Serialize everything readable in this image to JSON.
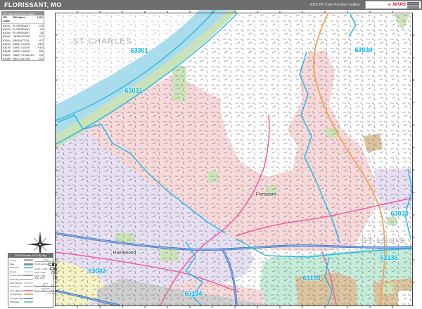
{
  "title_bar": {
    "title": "FLORISSANT, MO",
    "edition": "2020 ZIP Code Premium Edition",
    "logo_text": "MAPS"
  },
  "zip_index": {
    "header": "ZIP Code Index/Grid Locator",
    "columns": [
      "ZIP Code",
      "ZIP Name",
      "LOC"
    ],
    "rows": [
      {
        "code": "63031",
        "name": "FLORISSANT",
        "loc": "E5"
      },
      {
        "code": "63033",
        "name": "FLORISSANT",
        "loc": "L8"
      },
      {
        "code": "63034",
        "name": "FLORISSANT",
        "loc": "J3"
      },
      {
        "code": "63042",
        "name": "HAZELWOOD",
        "loc": "D7"
      },
      {
        "code": "63044",
        "name": "BRIDGETON",
        "loc": "B7"
      },
      {
        "code": "63134",
        "name": "SAINT LOUIS",
        "loc": "G10"
      },
      {
        "code": "63135",
        "name": "SAINT LOUIS",
        "loc": "K10"
      },
      {
        "code": "63136",
        "name": "SAINT LOUIS",
        "loc": "M9"
      },
      {
        "code": "63301",
        "name": "SAINT CHARLES",
        "loc": "D6"
      },
      {
        "code": "63386",
        "name": "WEST ALTON",
        "loc": "G1"
      }
    ]
  },
  "legend": {
    "header": "2020 Florissant, MO City Map",
    "items": [
      {
        "label": "County",
        "color": "#b3b3b3"
      },
      {
        "label": "State",
        "color": "#8c8c8c"
      },
      {
        "label": "ZIP Code",
        "color": "#4ec9ef"
      },
      {
        "label": "Streets",
        "color": "#d9d9d9"
      },
      {
        "label": "Primary Streets",
        "color": "#9e9e9e"
      },
      {
        "label": "Secondary Streets",
        "color": "#bdbdbd"
      },
      {
        "label": "Minor Streets",
        "color": "#d4d4d4"
      },
      {
        "label": "Exit Ramps",
        "color": "#c9c9c9"
      },
      {
        "label": "State Highways",
        "color": "#f07ab0"
      },
      {
        "label": "US Highways",
        "color": "#f5a55c"
      },
      {
        "label": "Interstate Highways",
        "color": "#6d9ce0"
      },
      {
        "label": "Toll Roads",
        "color": "#7fcf9a"
      }
    ],
    "cities_header": "Cities",
    "city_sizes": [
      {
        "label": "25,000 and Over",
        "sample": "City"
      },
      {
        "label": "10,000 - 24,999",
        "sample": "City"
      },
      {
        "label": "5,000 - 9,999",
        "sample": "City"
      },
      {
        "label": "1,000 - 4,999",
        "sample": "City"
      },
      {
        "label": "Under 1,000",
        "sample": "City"
      }
    ],
    "scale": {
      "miles": "Miles",
      "kilometers": "Kilometers"
    },
    "footnote": "MarketMAPS"
  },
  "map": {
    "zip_labels": [
      {
        "text": "63301"
      },
      {
        "text": "63031"
      },
      {
        "text": "63034"
      },
      {
        "text": "63033"
      },
      {
        "text": "63136"
      },
      {
        "text": "63135"
      },
      {
        "text": "63134"
      },
      {
        "text": "63042"
      }
    ],
    "area_labels": [
      {
        "text": "ST CHARLES"
      },
      {
        "text": "ST LOUIS"
      }
    ],
    "city_labels": [
      {
        "text": "Florissant"
      },
      {
        "text": "Hazelwood"
      }
    ]
  },
  "colors": {
    "zip_label": "#00b4ef",
    "zone_pink": "#f7d9da",
    "zone_lavender": "#e6e0f2",
    "zone_mint": "#c4ecd9",
    "zone_yellow": "#f6f3c4",
    "airport_gray": "#cfcfcf",
    "zone_tan": "#dbc49e",
    "river_blue": "#a9dcec",
    "park_green": "#cde4bb",
    "interstate_blue": "#5b8fd9",
    "state_highway_pink": "#ee5fa4",
    "us_highway_orange": "#f2a253",
    "boundary_cyan": "#2cb9e6"
  }
}
